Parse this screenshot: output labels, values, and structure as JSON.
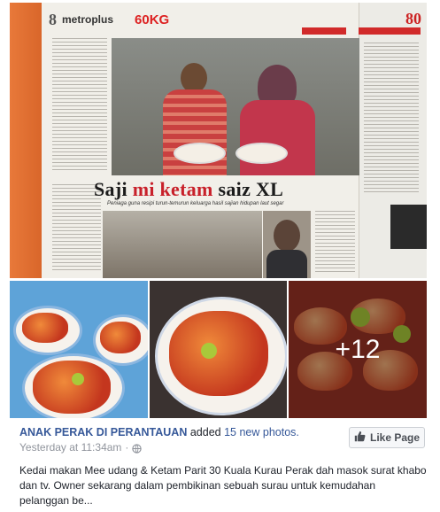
{
  "newspaper": {
    "page_number": "8",
    "section": "metroplus",
    "kicker": "60KG",
    "page_number_right": "80",
    "headline_part1": "Saji",
    "headline_red": "mi ketam",
    "headline_part2": "saiz XL",
    "subhead": "Peniaga guna resipi turun-temurun keluarga hasil sajian hidupan laut segar"
  },
  "gallery": {
    "more_count": "+12"
  },
  "post": {
    "page_name": "ANAK PERAK DI PERANTAUAN",
    "action_prefix": "added",
    "action_count": "15",
    "action_suffix": "new photos.",
    "timestamp": "Yesterday at 11:34am",
    "separator": "·",
    "like_button": "Like Page",
    "text": "Kedai makan Mee udang & Ketam Parit 30 Kuala Kurau Perak dah masok surat khabo dan tv. Owner sekarang dalam pembikinan sebuah surau untuk kemudahan pelanggan be..."
  },
  "colors": {
    "link": "#365899",
    "meta_grey": "#90949c",
    "text": "#1d2129"
  },
  "icons": [
    "globe-icon",
    "thumbs-up-icon"
  ]
}
